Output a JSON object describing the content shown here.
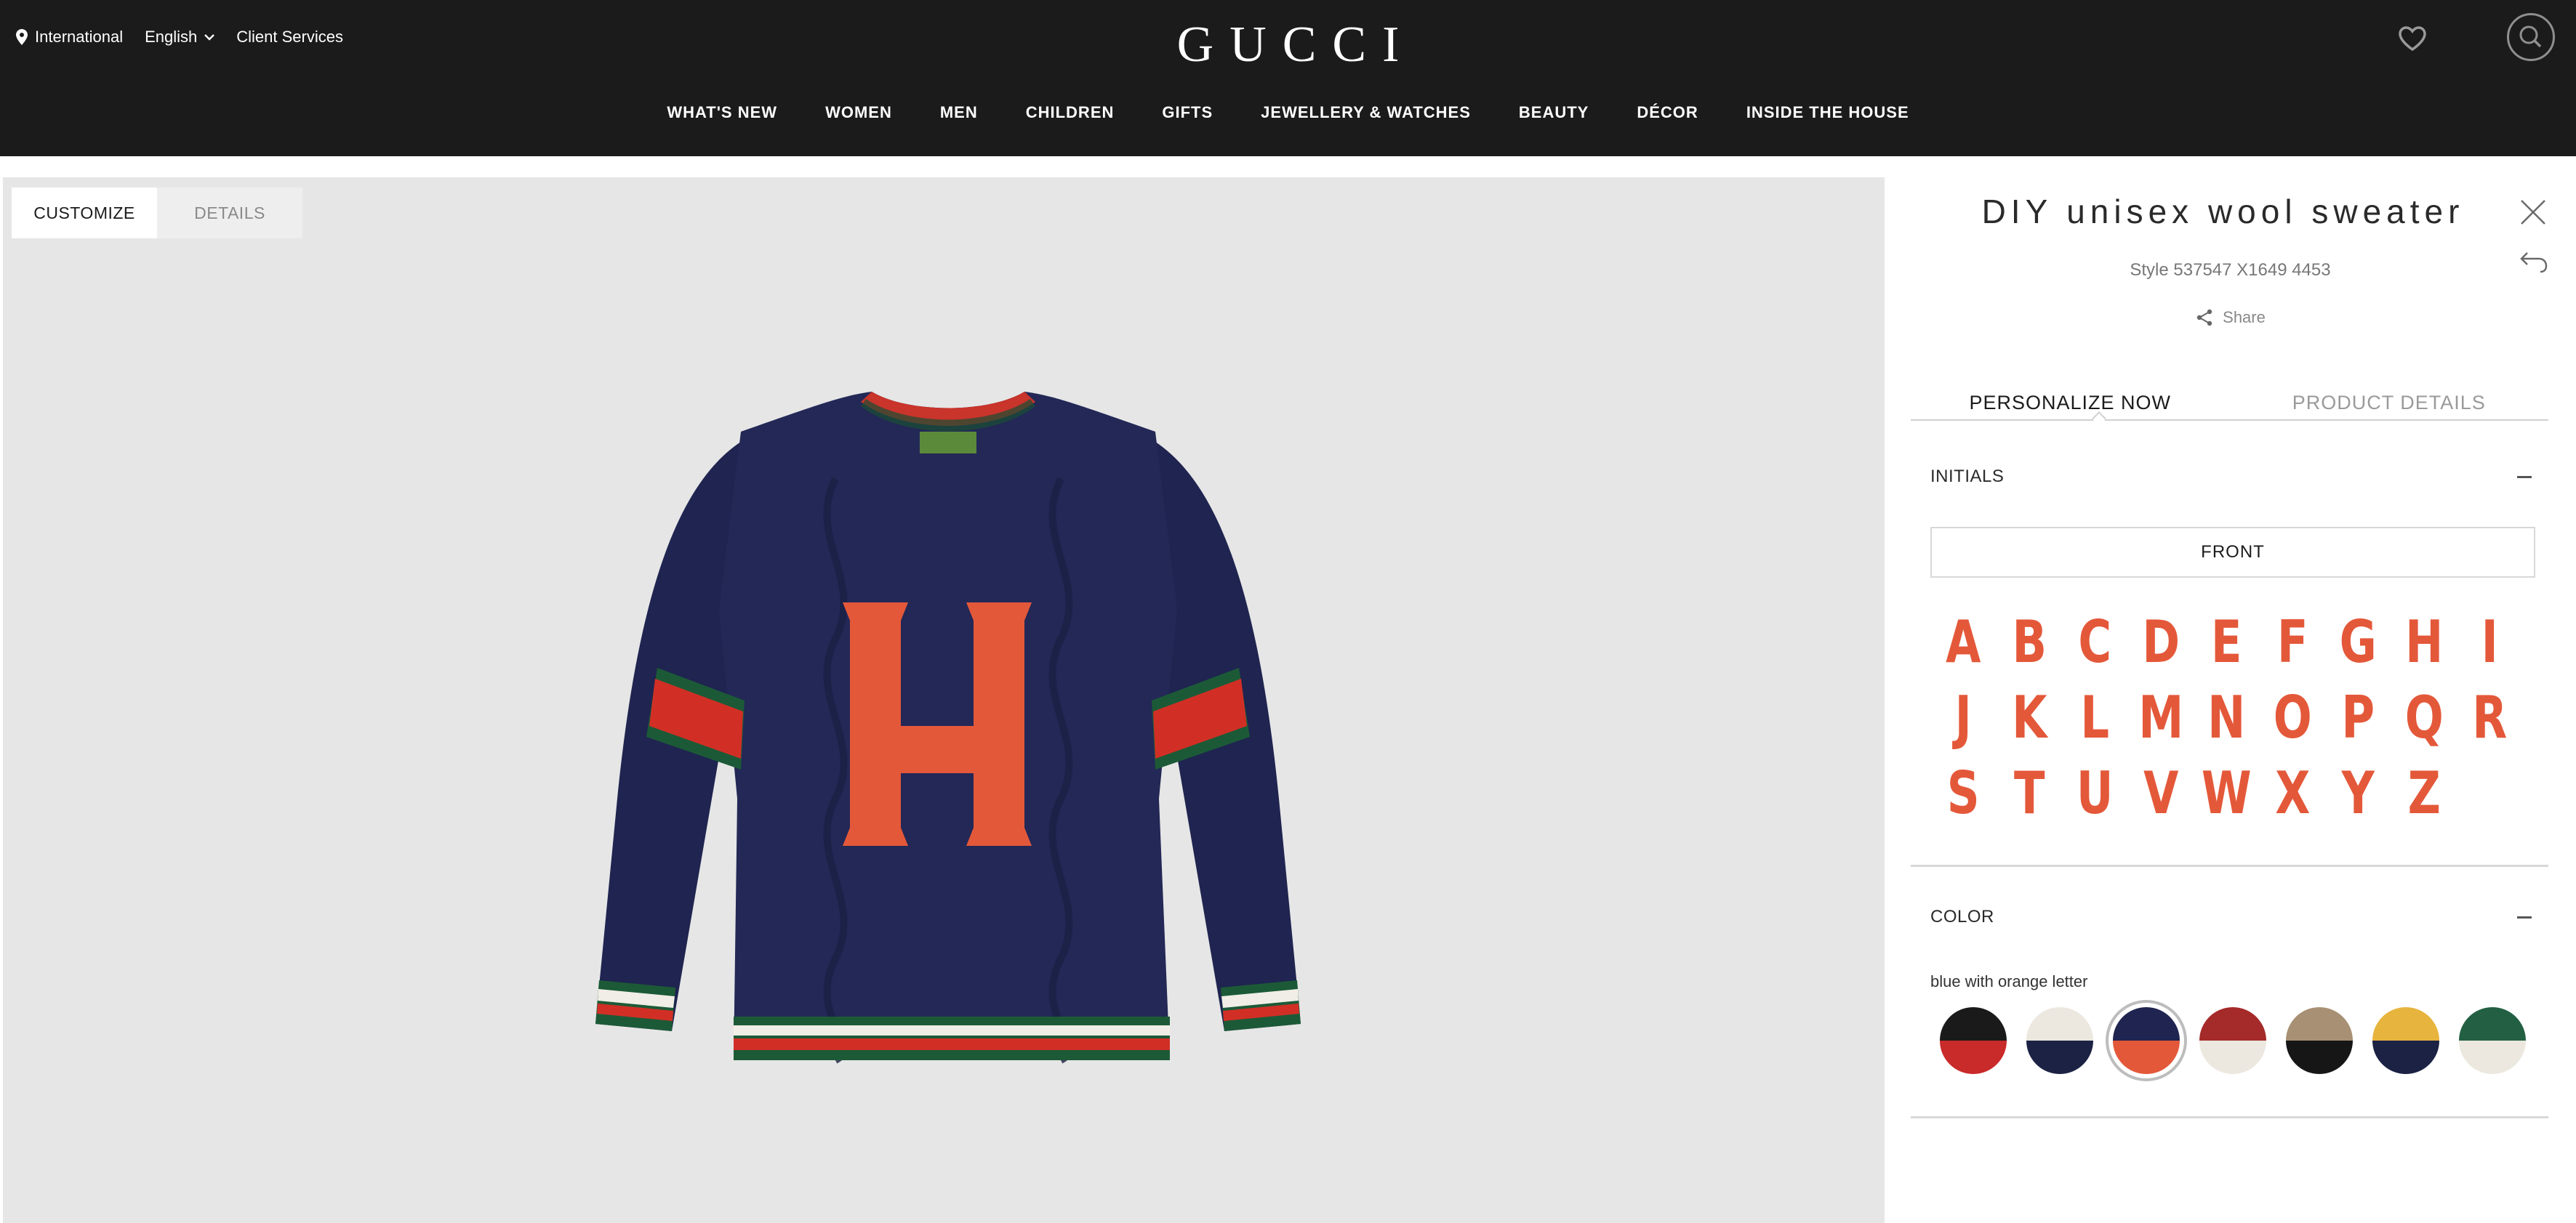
{
  "header": {
    "international_label": "International",
    "language_label": "English",
    "client_services_label": "Client Services",
    "logo_text": "GUCCI",
    "nav": [
      "WHAT'S NEW",
      "WOMEN",
      "MEN",
      "CHILDREN",
      "GIFTS",
      "JEWELLERY & WATCHES",
      "BEAUTY",
      "DÉCOR",
      "INSIDE THE HOUSE"
    ]
  },
  "viewer": {
    "tabs": [
      "CUSTOMIZE",
      "DETAILS"
    ],
    "active_tab": "CUSTOMIZE",
    "product_letter": "H",
    "sweater_body_color": "#1f2450",
    "letter_color": "#e4583a"
  },
  "panel": {
    "title": "DIY unisex wool sweater",
    "style": "Style 537547 X1649 4453",
    "share_label": "Share",
    "tabs": [
      "PERSONALIZE NOW",
      "PRODUCT DETAILS"
    ],
    "active_tab": "PERSONALIZE NOW",
    "initials": {
      "heading": "INITIALS",
      "placement": "FRONT",
      "letters": [
        "A",
        "B",
        "C",
        "D",
        "E",
        "F",
        "G",
        "H",
        "I",
        "J",
        "K",
        "L",
        "M",
        "N",
        "O",
        "P",
        "Q",
        "R",
        "S",
        "T",
        "U",
        "V",
        "W",
        "X",
        "Y",
        "Z"
      ],
      "letter_color": "#e4583a"
    },
    "color": {
      "heading": "COLOR",
      "selected_name": "blue with orange letter",
      "swatches": [
        {
          "top": "#1a1a1a",
          "bottom": "#c92a2a"
        },
        {
          "top": "#ece8df",
          "bottom": "#1c2244"
        },
        {
          "top": "#1f2450",
          "bottom": "#e4583a",
          "selected": true
        },
        {
          "top": "#a52a2a",
          "bottom": "#ece8df"
        },
        {
          "top": "#a89074",
          "bottom": "#161616"
        },
        {
          "top": "#e7b43d",
          "bottom": "#1c2244"
        },
        {
          "top": "#236043",
          "bottom": "#ece8df"
        }
      ]
    }
  }
}
